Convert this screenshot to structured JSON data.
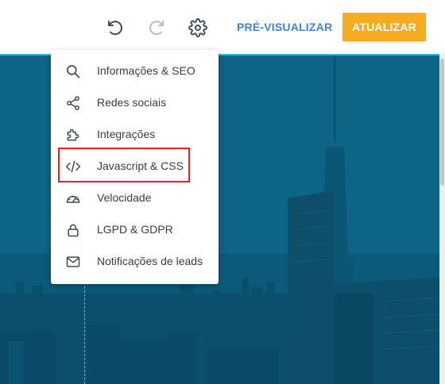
{
  "toolbar": {
    "undo_icon": "undo-icon",
    "redo_icon": "redo-icon",
    "settings_icon": "gear-icon",
    "preview_label": "PRÉ-VISUALIZAR",
    "update_label": "ATUALIZAR"
  },
  "menu": {
    "items": [
      {
        "label": "Informações & SEO",
        "icon": "search-icon"
      },
      {
        "label": "Redes sociais",
        "icon": "share-icon"
      },
      {
        "label": "Integrações",
        "icon": "puzzle-icon"
      },
      {
        "label": "Javascript & CSS",
        "icon": "code-icon"
      },
      {
        "label": "Velocidade",
        "icon": "speedometer-icon"
      },
      {
        "label": "LGPD & GDPR",
        "icon": "lock-icon"
      },
      {
        "label": "Notificações de leads",
        "icon": "mail-icon"
      }
    ]
  },
  "colors": {
    "accent_orange": "#f7ab1e",
    "link_blue": "#3f83d1",
    "canvas_border": "#29b6d8",
    "highlight_red": "#e02424"
  }
}
